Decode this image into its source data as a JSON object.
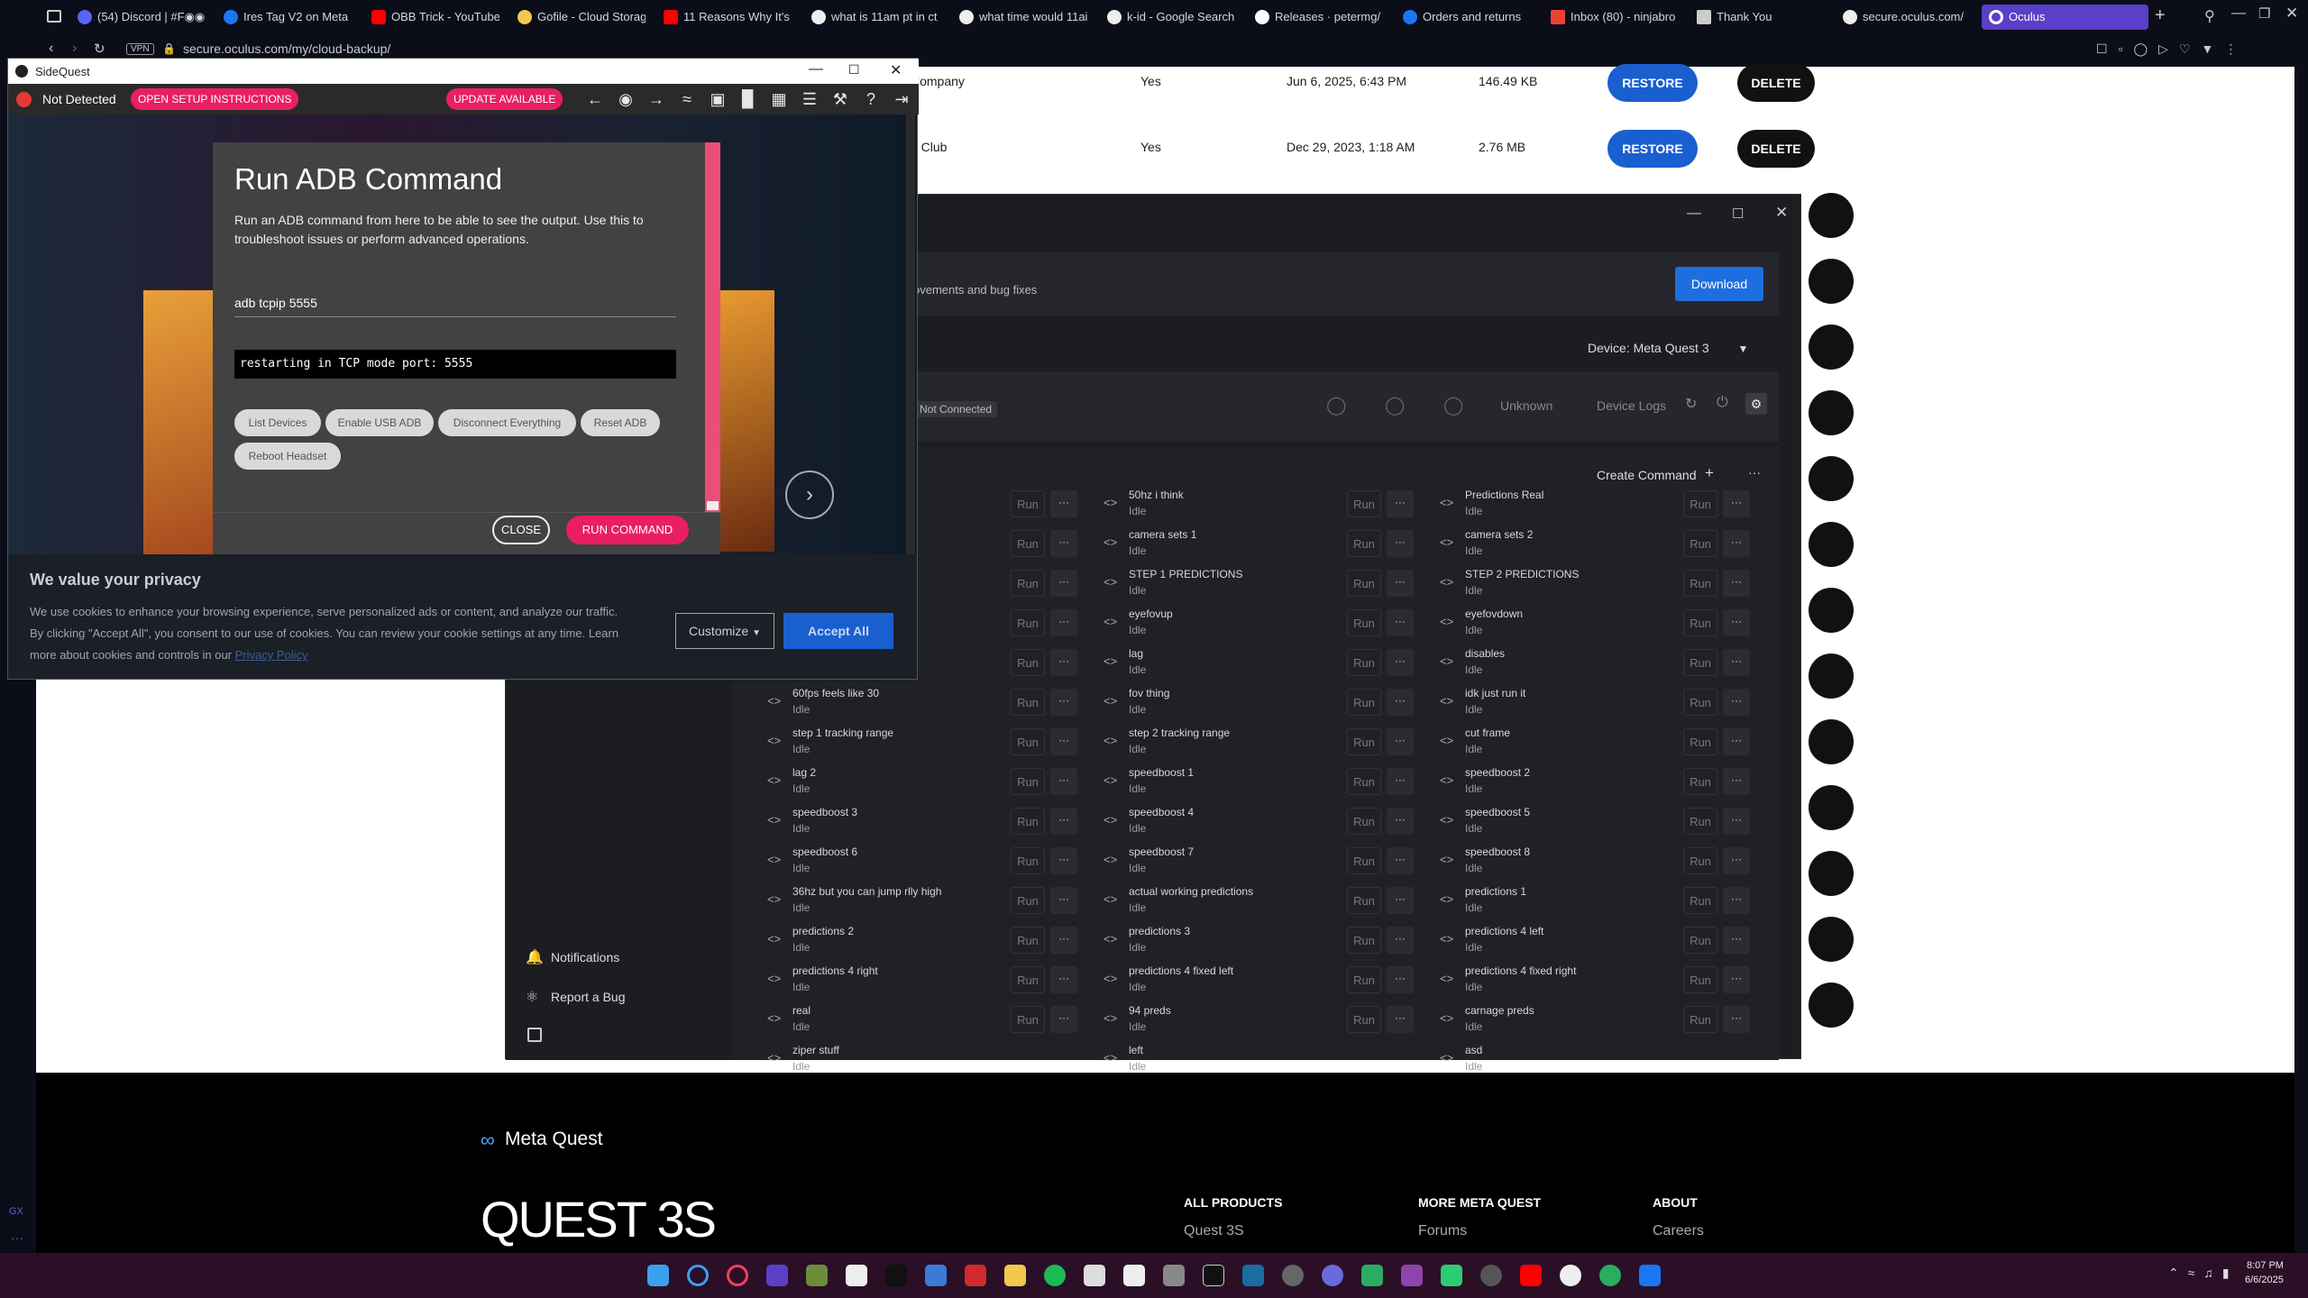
{
  "browser": {
    "tabs": [
      {
        "label": "(54) Discord | #F◉◉"
      },
      {
        "label": "Ires Tag V2 on Meta"
      },
      {
        "label": "OBB Trick - YouTube"
      },
      {
        "label": "Gofile - Cloud Storag"
      },
      {
        "label": "11 Reasons Why It's"
      },
      {
        "label": "what is 11am pt in ct"
      },
      {
        "label": "what time would 11ai"
      },
      {
        "label": "k-id - Google Search"
      },
      {
        "label": "Releases · petermg/"
      },
      {
        "label": "Orders and returns"
      },
      {
        "label": "Inbox (80) - ninjabro"
      },
      {
        "label": "Thank You"
      },
      {
        "label": "secure.oculus.com/"
      },
      {
        "label": "Oculus"
      }
    ],
    "vpn": "VPN",
    "url": "secure.oculus.com/my/cloud-backup/",
    "gx": "GX"
  },
  "backups": [
    {
      "name": "Company",
      "yes": "Yes",
      "date": "Jun 6, 2025, 6:43 PM",
      "size": "146.49 KB",
      "restore": "RESTORE",
      "delete": "DELETE"
    },
    {
      "name": "e Club",
      "yes": "Yes",
      "date": "Dec 29, 2023, 1:18 AM",
      "size": "2.76 MB",
      "restore": "RESTORE",
      "delete": "DELETE"
    }
  ],
  "sqapp": {
    "update_text": "ovements and bug fixes",
    "download": "Download",
    "device": "Device: Meta Quest 3",
    "not_connected": "Not Connected",
    "unknown": "Unknown",
    "device_logs": "Device Logs",
    "create_command": "Create Command",
    "notifications": "Notifications",
    "report_bug": "Report a Bug",
    "run": "Run",
    "more": "···",
    "code": "<>",
    "commands": [
      [
        "",
        "50hz i think",
        "Predictions Real"
      ],
      [
        "",
        "camera sets 1",
        "camera sets 2"
      ],
      [
        "",
        "STEP 1 PREDICTIONS",
        "STEP 2 PREDICTIONS"
      ],
      [
        "",
        "eyefovup",
        "eyefovdown"
      ],
      [
        "",
        "lag",
        "disables"
      ],
      [
        "60fps feels like 30",
        "fov thing",
        "idk just run it"
      ],
      [
        "step 1 tracking range",
        "step 2 tracking range",
        "cut frame"
      ],
      [
        "lag 2",
        "speedboost 1",
        "speedboost 2"
      ],
      [
        "speedboost 3",
        "speedboost 4",
        "speedboost 5"
      ],
      [
        "speedboost 6",
        "speedboost 7",
        "speedboost 8"
      ],
      [
        "36hz but you can jump rlly high",
        "actual working predictions",
        "predictions 1"
      ],
      [
        "predictions 2",
        "predictions 3",
        "predictions 4 left"
      ],
      [
        "predictions 4 right",
        "predictions 4 fixed left",
        "predictions 4 fixed right"
      ],
      [
        "real",
        "94 preds",
        "carnage preds"
      ],
      [
        "ziper stuff",
        "left",
        "asd"
      ]
    ],
    "idle": "Idle"
  },
  "sidequest": {
    "title": "SideQuest",
    "not_detected": "Not Detected",
    "setup": "OPEN SETUP INSTRUCTIONS",
    "update": "UPDATE AVAILABLE"
  },
  "modal": {
    "title": "Run ADB Command",
    "desc": "Run an ADB command from here to be able to see the output. Use this to troubleshoot issues or perform advanced operations.",
    "input": "adb tcpip 5555",
    "output": "restarting in TCP mode port: 5555",
    "buttons": [
      "List Devices",
      "Enable USB ADB",
      "Disconnect Everything",
      "Reset ADB",
      "Reboot Headset"
    ],
    "close": "CLOSE",
    "run": "RUN COMMAND"
  },
  "privacy": {
    "title": "We value your privacy",
    "text1": "We use cookies to enhance your browsing experience, serve personalized ads or content, and analyze our traffic.",
    "text2": "By clicking \"Accept All\", you consent to our use of cookies. You can review your cookie settings at any time. Learn",
    "text3": "more about cookies and controls in our",
    "policy": "Privacy Policy",
    "customize": "Customize",
    "accept": "Accept All"
  },
  "footer": {
    "brand": "Meta Quest",
    "hero": "QUEST 3S",
    "cols": [
      {
        "head": "ALL PRODUCTS",
        "item": "Quest 3S"
      },
      {
        "head": "MORE META QUEST",
        "item": "Forums"
      },
      {
        "head": "ABOUT",
        "item": "Careers"
      }
    ]
  },
  "taskbar": {
    "time": "8:07 PM",
    "date": "6/6/2025"
  },
  "colors": {
    "accent": "#1a5fd0",
    "sq_pink": "#e91e63",
    "taskbar": "#2a0f27",
    "opera_tab": "#5a3fc8"
  }
}
